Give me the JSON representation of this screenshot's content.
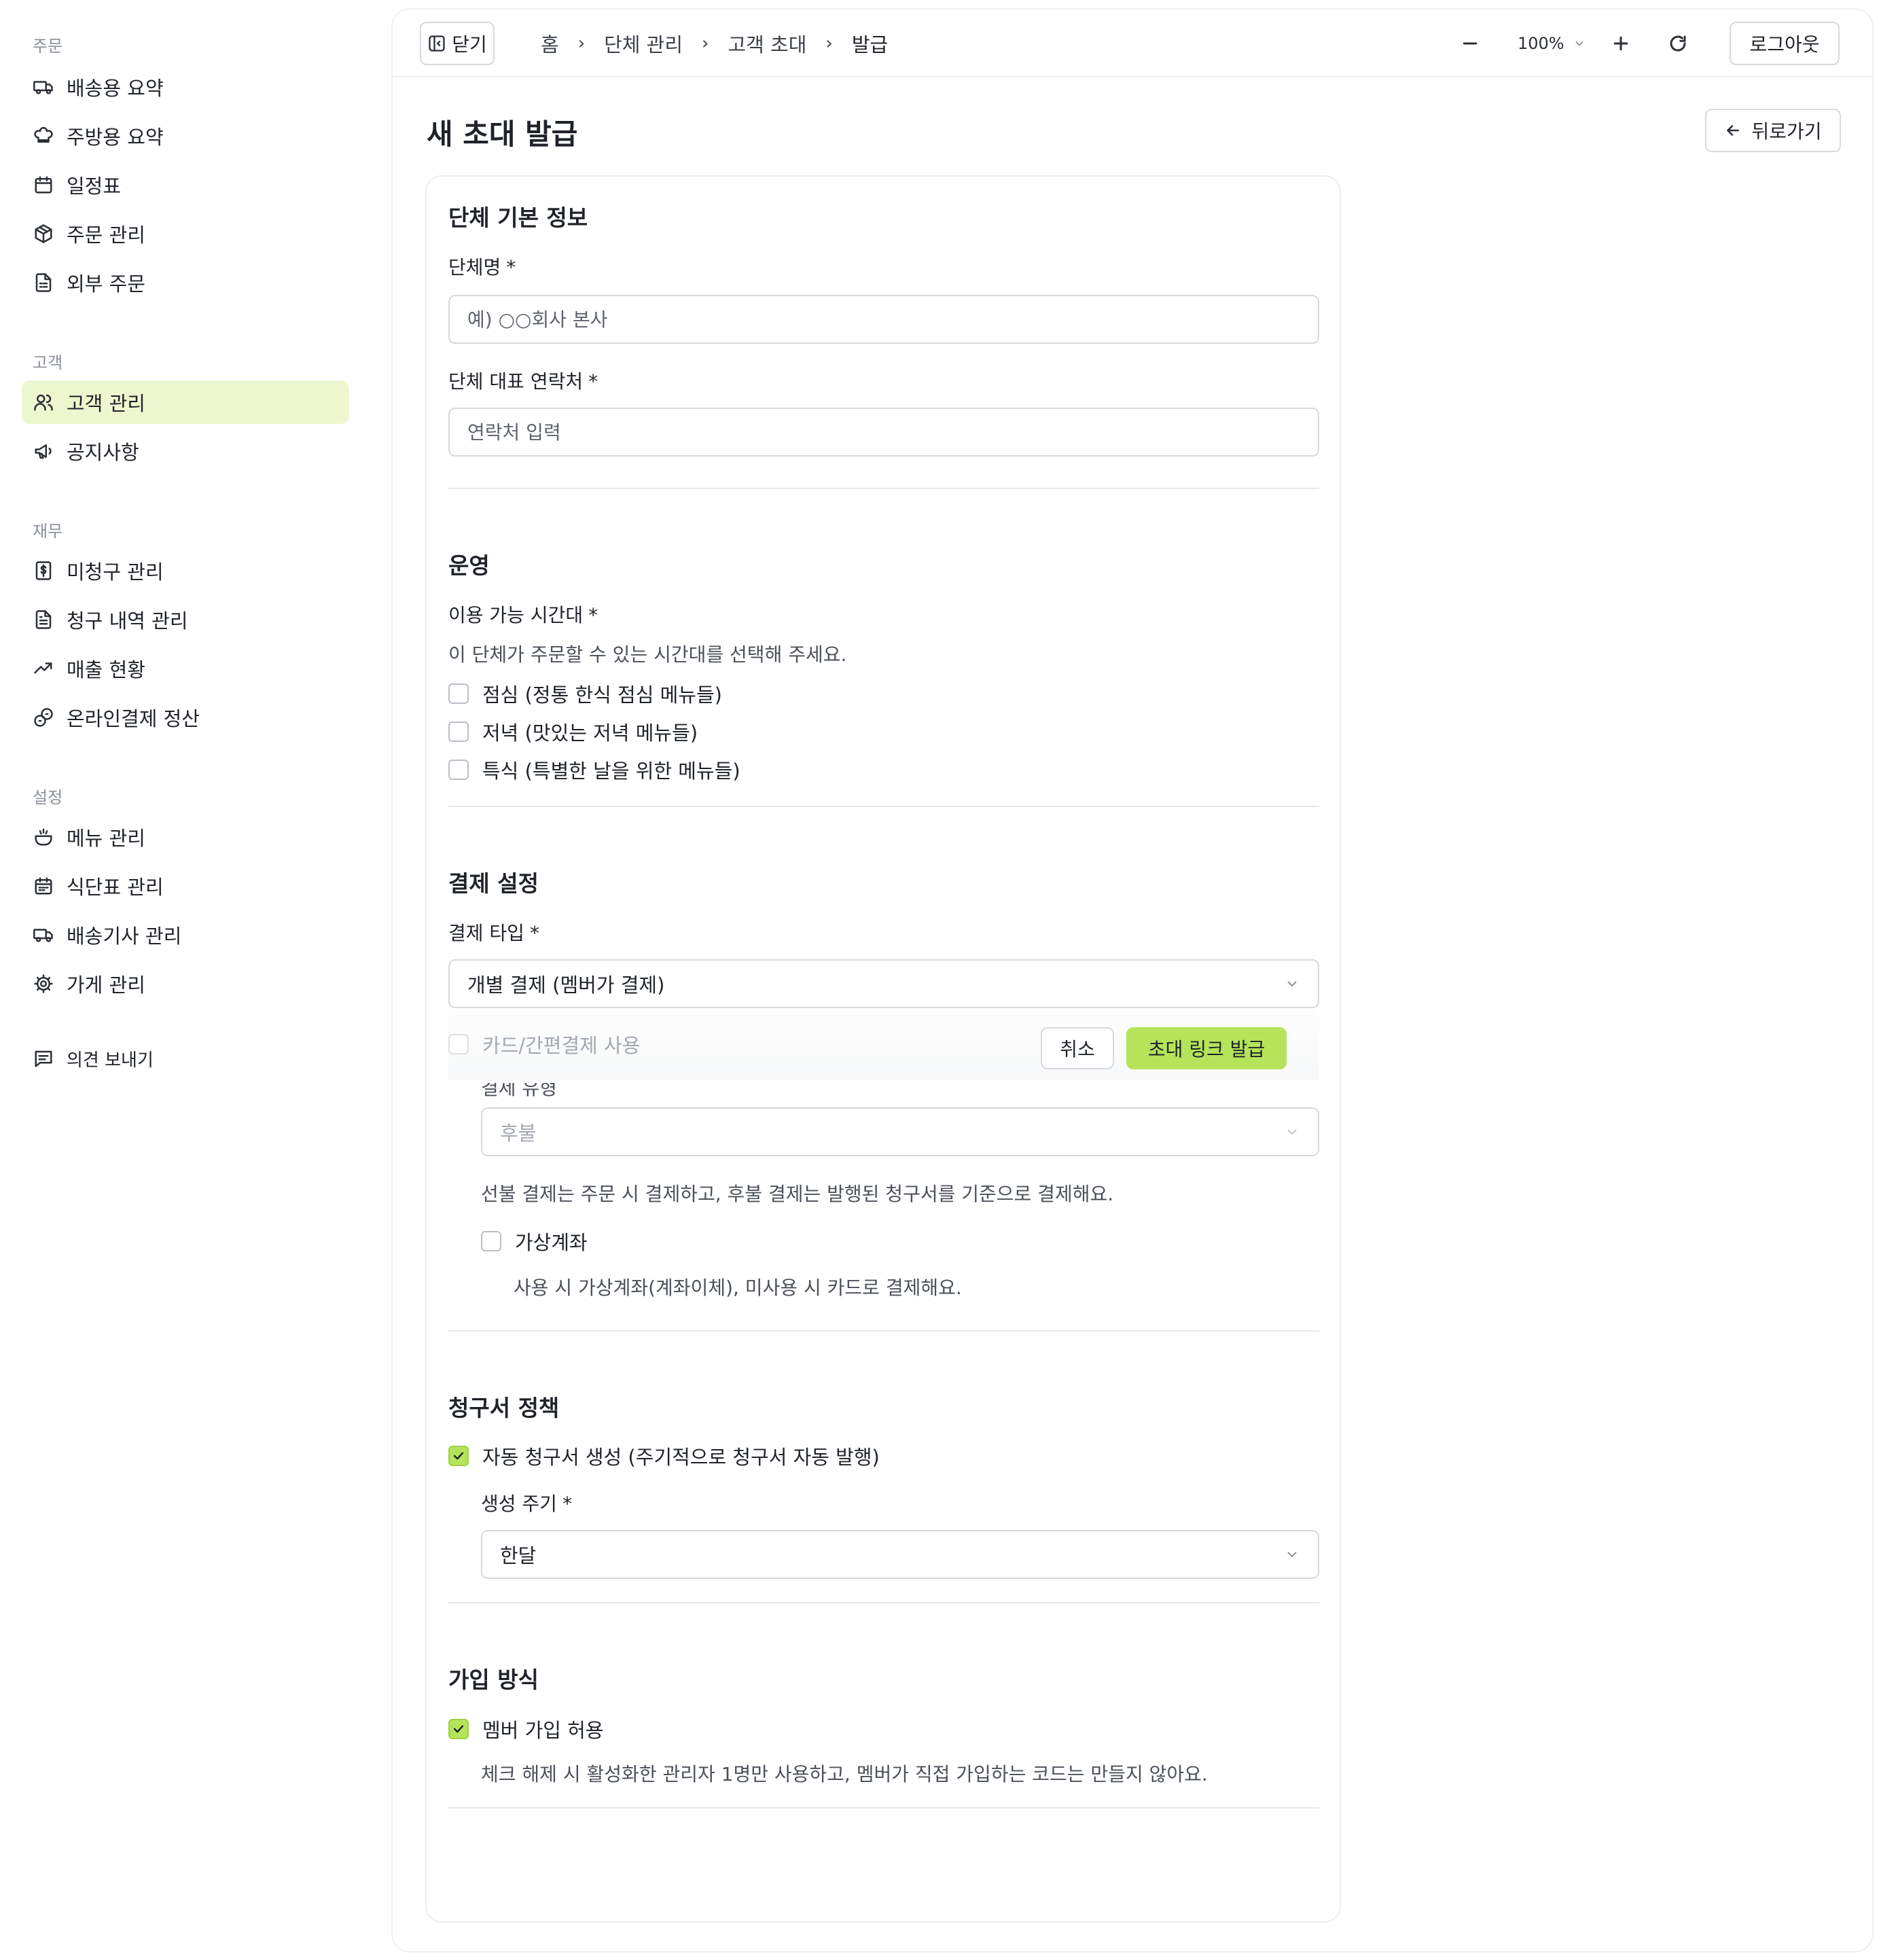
{
  "sidebar": {
    "sections": [
      {
        "label": "주문",
        "items": [
          {
            "label": "배송용 요약",
            "icon": "truck-icon"
          },
          {
            "label": "주방용 요약",
            "icon": "chef-hat-icon"
          },
          {
            "label": "일정표",
            "icon": "calendar-icon"
          },
          {
            "label": "주문 관리",
            "icon": "package-icon"
          },
          {
            "label": "외부 주문",
            "icon": "file-list-icon"
          }
        ]
      },
      {
        "label": "고객",
        "items": [
          {
            "label": "고객 관리",
            "icon": "users-icon",
            "active": true
          },
          {
            "label": "공지사항",
            "icon": "megaphone-icon"
          }
        ]
      },
      {
        "label": "재무",
        "items": [
          {
            "label": "미청구 관리",
            "icon": "dollar-receipt-icon"
          },
          {
            "label": "청구 내역 관리",
            "icon": "document-icon"
          },
          {
            "label": "매출 현황",
            "icon": "trending-up-icon"
          },
          {
            "label": "온라인결제 정산",
            "icon": "coins-icon"
          }
        ]
      },
      {
        "label": "설정",
        "items": [
          {
            "label": "메뉴 관리",
            "icon": "dish-icon"
          },
          {
            "label": "식단표 관리",
            "icon": "calendar-grid-icon"
          },
          {
            "label": "배송기사 관리",
            "icon": "truck-icon"
          },
          {
            "label": "가게 관리",
            "icon": "gear-icon"
          }
        ]
      }
    ],
    "feedback": {
      "label": "의견 보내기",
      "icon": "message-icon"
    }
  },
  "topbar": {
    "close_label": "닫기",
    "breadcrumbs": [
      "홈",
      "단체 관리",
      "고객 초대",
      "발급"
    ],
    "zoom": "100%",
    "logout_label": "로그아웃"
  },
  "page": {
    "title": "새 초대 발급",
    "back_label": "뒤로가기"
  },
  "form": {
    "basic": {
      "heading": "단체 기본 정보",
      "name_label": "단체명",
      "name_placeholder": "예) ○○회사 본사",
      "contact_label": "단체 대표 연락처",
      "contact_placeholder": "연락처 입력"
    },
    "operation": {
      "heading": "운영",
      "time_label": "이용 가능 시간대",
      "time_help": "이 단체가 주문할 수 있는 시간대를 선택해 주세요.",
      "options": [
        {
          "label": "점심 (정통 한식 점심 메뉴들)",
          "checked": false
        },
        {
          "label": "저녁 (맛있는 저녁 메뉴들)",
          "checked": false
        },
        {
          "label": "특식 (특별한 날을 위한 메뉴들)",
          "checked": false
        }
      ]
    },
    "payment": {
      "heading": "결제 설정",
      "type_label": "결제 타입",
      "type_value": "개별 결제 (멤버가 결제)",
      "card_label": "카드/간편결제 사용",
      "method_label": "결제 유형",
      "method_value": "후불",
      "method_help": "선불 결제는 주문 시 결제하고, 후불 결제는 발행된 청구서를 기준으로 결제해요.",
      "virtual_label": "가상계좌",
      "virtual_help": "사용 시 가상계좌(계좌이체), 미사용 시 카드로 결제해요."
    },
    "invoice": {
      "heading": "청구서 정책",
      "auto_label": "자동 청구서 생성 (주기적으로 청구서 자동 발행)",
      "auto_checked": true,
      "cycle_label": "생성 주기",
      "cycle_value": "한달"
    },
    "signup": {
      "heading": "가입 방식",
      "allow_label": "멤버 가입 허용",
      "allow_checked": true,
      "allow_help": "체크 해제 시 활성화한 관리자 1명만 사용하고, 멤버가 직접 가입하는 코드는 만들지 않아요."
    },
    "actions": {
      "cancel_label": "취소",
      "issue_label": "초대 링크 발급"
    },
    "required_mark": "*"
  },
  "colors": {
    "accent": "#b5e45a",
    "active_nav_bg": "#ecf7cf",
    "border": "#d6d9de"
  }
}
